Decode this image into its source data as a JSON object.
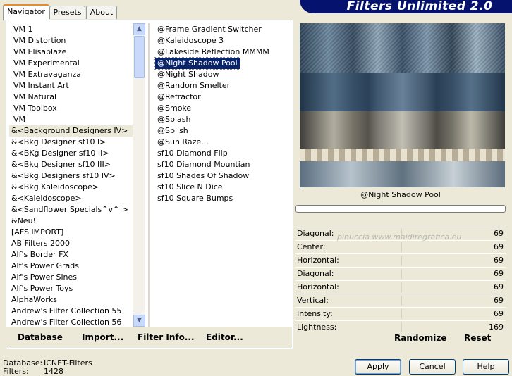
{
  "tabs": [
    {
      "label": "Navigator"
    },
    {
      "label": "Presets"
    },
    {
      "label": "About"
    }
  ],
  "title": "Filters Unlimited 2.0",
  "categories": [
    "VM 1",
    "VM Distortion",
    "VM Elisablaze",
    "VM Experimental",
    "VM Extravaganza",
    "VM Instant Art",
    "VM Natural",
    "VM Toolbox",
    "VM",
    "&<Background Designers IV>",
    "&<Bkg Designer sf10 I>",
    "&<BKg Designer sf10 II>",
    "&<Bkg Designer sf10 III>",
    "&<Bkg Designers sf10 IV>",
    "&<Bkg Kaleidoscope>",
    "&<Kaleidoscope>",
    "&<Sandflower Specials^v^ >",
    "&Neu!",
    "[AFS IMPORT]",
    "AB Filters 2000",
    "Alf's Border FX",
    "Alf's Power Grads",
    "Alf's Power Sines",
    "Alf's Power Toys",
    "AlphaWorks",
    "Andrew's Filter Collection 55",
    "Andrew's Filter Collection 56"
  ],
  "selected_category_index": 9,
  "filters": [
    "@Frame Gradient Switcher",
    "@Kaleidoscope 3",
    "@Lakeside Reflection MMMM",
    "@Night Shadow Pool",
    "@Night Shadow",
    "@Random Smelter",
    "@Refractor",
    "@Smoke",
    "@Splash",
    "@Splish",
    "@Sun Raze...",
    "sf10 Diamond Flip",
    "sf10 Diamond Mountian",
    "sf10 Shades Of Shadow",
    "sf10 Slice N Dice",
    "sf10 Square Bumps"
  ],
  "selected_filter_index": 3,
  "toolbar": {
    "database": "Database",
    "import": "Import...",
    "filter_info": "Filter Info...",
    "editor": "Editor..."
  },
  "preview_label": "@Night Shadow Pool",
  "params": [
    {
      "label": "Diagonal:",
      "value": "69"
    },
    {
      "label": "Center:",
      "value": "69"
    },
    {
      "label": "Horizontal:",
      "value": "69"
    },
    {
      "label": "Diagonal:",
      "value": "69"
    },
    {
      "label": "Horizontal:",
      "value": "69"
    },
    {
      "label": "Vertical:",
      "value": "69"
    },
    {
      "label": "Intensity:",
      "value": "69"
    },
    {
      "label": "Lightness:",
      "value": "169"
    }
  ],
  "randomize": "Randomize",
  "reset": "Reset",
  "status": {
    "database_label": "Database:",
    "database_value": "ICNET-Filters",
    "filters_label": "Filters:",
    "filters_value": "1428"
  },
  "buttons": {
    "apply": "Apply",
    "cancel": "Cancel",
    "help": "Help"
  },
  "watermark": "pinuccia www.maidiregrafica.eu"
}
